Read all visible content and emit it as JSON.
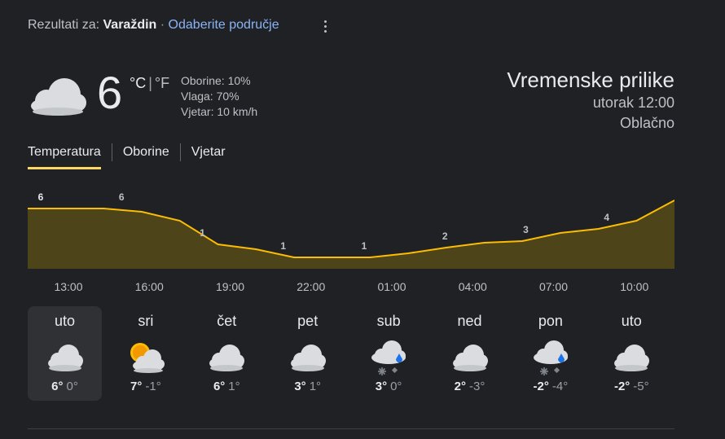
{
  "header": {
    "prefix": "Rezultati za:",
    "location": "Varaždin",
    "separator": "·",
    "change_area_link": "Odaberite područje"
  },
  "current": {
    "temperature": "6",
    "unit_c": "°C",
    "unit_sep": "|",
    "unit_f": "°F",
    "precipitation": "Oborine: 10%",
    "humidity": "Vlaga: 70%",
    "wind": "Vjetar: 10 km/h",
    "icon": "cloudy-icon"
  },
  "summary": {
    "title": "Vremenske prilike",
    "datetime": "utorak 12:00",
    "condition": "Oblačno"
  },
  "tabs": [
    {
      "label": "Temperatura",
      "active": true
    },
    {
      "label": "Oborine",
      "active": false
    },
    {
      "label": "Vjetar",
      "active": false
    }
  ],
  "chart_data": {
    "type": "area",
    "x": [
      "13:00",
      "16:00",
      "19:00",
      "22:00",
      "01:00",
      "04:00",
      "07:00",
      "10:00"
    ],
    "values": [
      6,
      6,
      1,
      1,
      1,
      2,
      3,
      4
    ],
    "profile": [
      6,
      6,
      6,
      5.6,
      4.5,
      1.6,
      1,
      0,
      0,
      0,
      0.5,
      1.2,
      1.8,
      2,
      3,
      3.5,
      4.5,
      7
    ],
    "ylim": [
      -2,
      8
    ],
    "colors": {
      "line": "#fbbc04",
      "fill": "#4d4419",
      "label": "#bdc1c6",
      "first_label": "#e8eaed"
    }
  },
  "days": [
    {
      "name": "uto",
      "high": "6°",
      "low": "0°",
      "icon": "cloudy-icon",
      "selected": true
    },
    {
      "name": "sri",
      "high": "7°",
      "low": "-1°",
      "icon": "partly-cloudy-icon",
      "selected": false
    },
    {
      "name": "čet",
      "high": "6°",
      "low": "1°",
      "icon": "cloudy-icon",
      "selected": false
    },
    {
      "name": "pet",
      "high": "3°",
      "low": "1°",
      "icon": "cloudy-icon",
      "selected": false
    },
    {
      "name": "sub",
      "high": "3°",
      "low": "0°",
      "icon": "snow-rain-icon",
      "selected": false
    },
    {
      "name": "ned",
      "high": "2°",
      "low": "-3°",
      "icon": "cloudy-icon",
      "selected": false
    },
    {
      "name": "pon",
      "high": "-2°",
      "low": "-4°",
      "icon": "snow-rain-icon",
      "selected": false
    },
    {
      "name": "uto",
      "high": "-2°",
      "low": "-5°",
      "icon": "cloudy-icon",
      "selected": false
    }
  ]
}
